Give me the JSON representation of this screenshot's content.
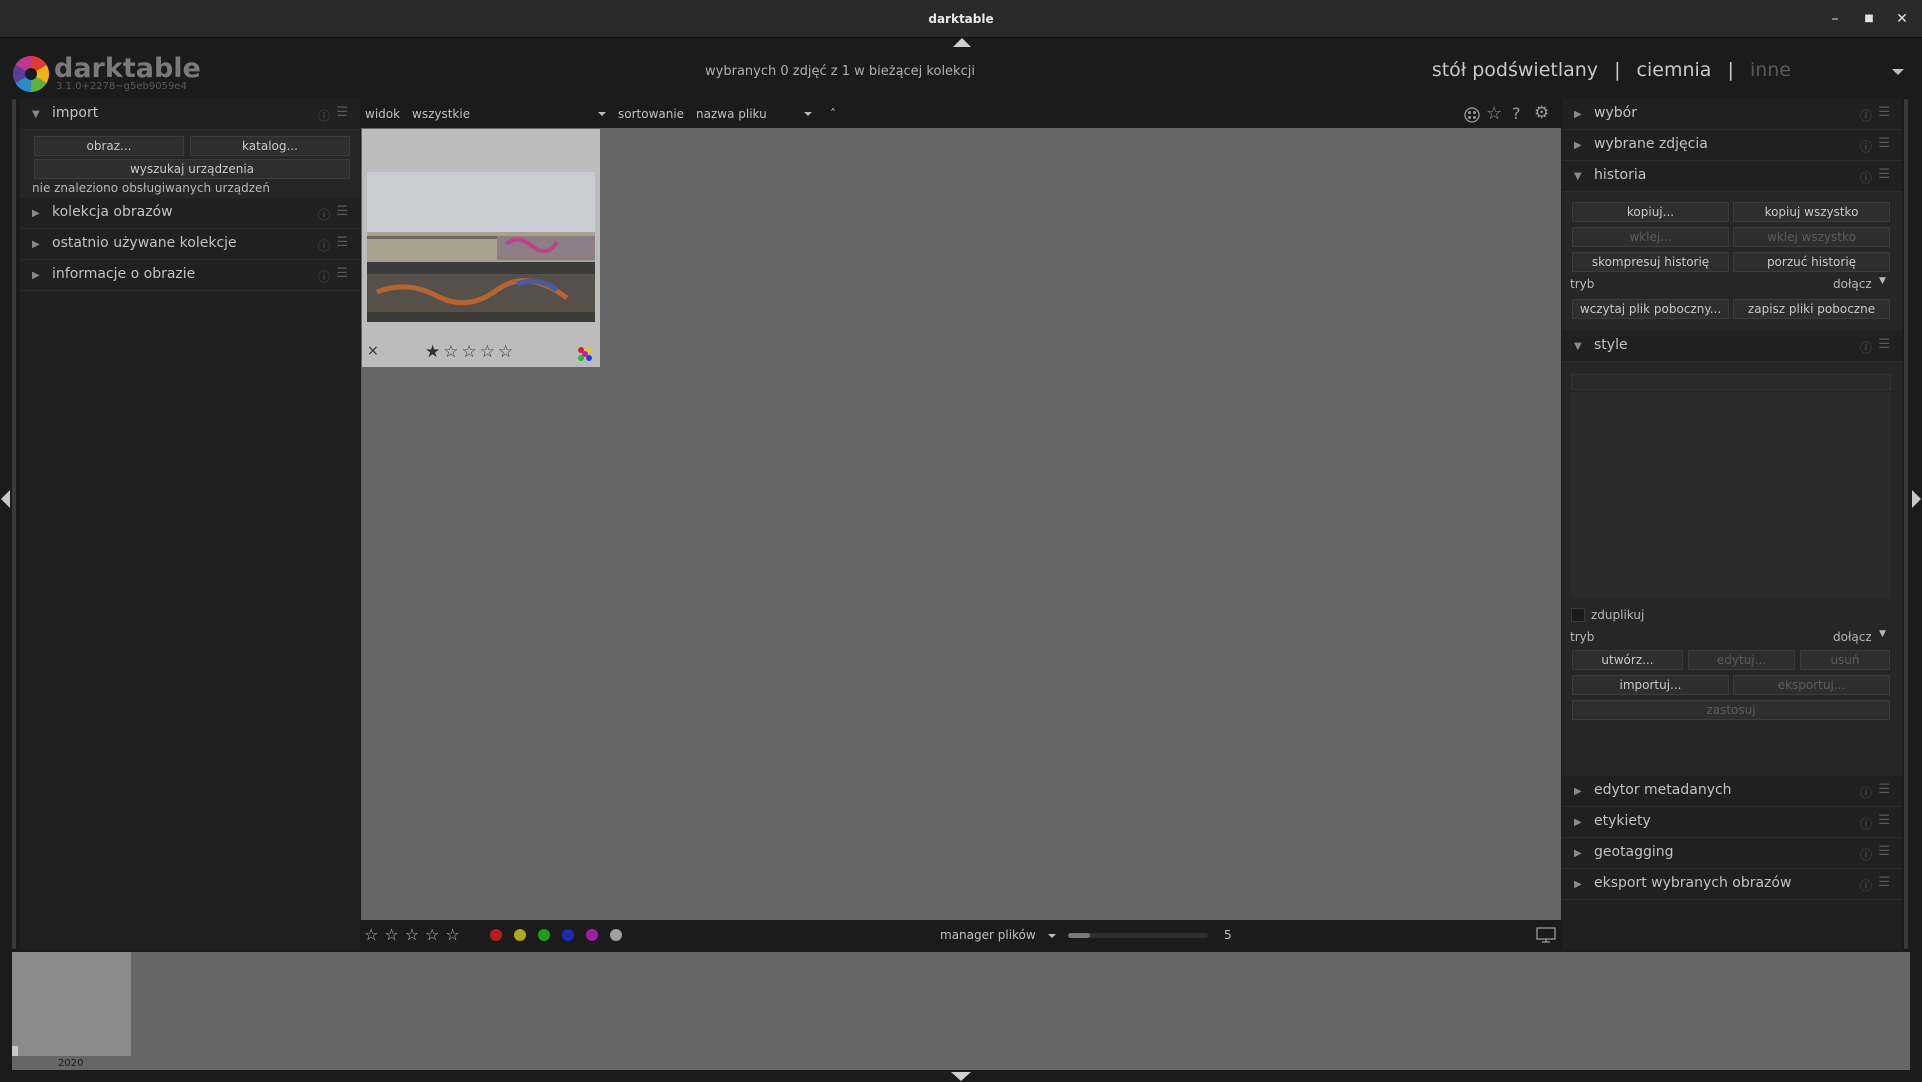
{
  "window": {
    "title": "darktable"
  },
  "app": {
    "name": "darktable",
    "version": "3.1.0+2278~g5eb9059e4"
  },
  "header": {
    "status": "wybranych 0 zdjęć z 1 w bieżącej kolekcji",
    "views": [
      "stół podświetlany",
      "ciemnia",
      "inne"
    ],
    "separator": "|"
  },
  "filterbar": {
    "view_label": "widok",
    "view_value": "wszystkie",
    "sort_label": "sortowanie",
    "sort_value": "nazwa pliku",
    "sort_dir": "˄"
  },
  "left": {
    "import": {
      "title": "import",
      "image_btn": "obraz...",
      "catalog_btn": "katalog...",
      "scan_btn": "wyszukaj urządzenia",
      "no_devices": "nie znaleziono obsługiwanych urządzeń"
    },
    "modules": [
      "kolekcja obrazów",
      "ostatnio używane kolekcje",
      "informacje o obrazie"
    ]
  },
  "right": {
    "top_modules": [
      "wybór",
      "wybrane zdjęcia"
    ],
    "history": {
      "title": "historia",
      "copy": "kopiuj...",
      "copy_all": "kopiuj wszystko",
      "paste": "wklej...",
      "paste_all": "wklej wszystko",
      "compress": "skompresuj historię",
      "discard": "porzuć historię",
      "mode_label": "tryb",
      "mode_value": "dołącz",
      "load_sidecar": "wczytaj plik poboczny...",
      "write_sidecar": "zapisz pliki poboczne"
    },
    "styles": {
      "title": "style",
      "duplicate": "zduplikuj",
      "mode_label": "tryb",
      "mode_value": "dołącz",
      "create": "utwórz...",
      "edit": "edytuj...",
      "remove": "usuń",
      "import": "importuj...",
      "export": "eksportuj...",
      "apply": "zastosuj"
    },
    "bottom_modules": [
      "edytor metadanych",
      "etykiety",
      "geotagging",
      "eksport wybranych obrazów"
    ]
  },
  "thumbnail": {
    "reject": "×",
    "stars": "★☆☆☆☆",
    "rating": 1
  },
  "bottombar": {
    "stars": "☆☆☆☆☆",
    "color_labels": [
      "#b81c1c",
      "#b0a81c",
      "#1ca01c",
      "#1c2ab0",
      "#a01ca0",
      "#a0a0a0"
    ],
    "layout": "manager plików",
    "zoom": "5",
    "zoom_fraction": 0.16
  },
  "timeline": {
    "year": "2020"
  }
}
